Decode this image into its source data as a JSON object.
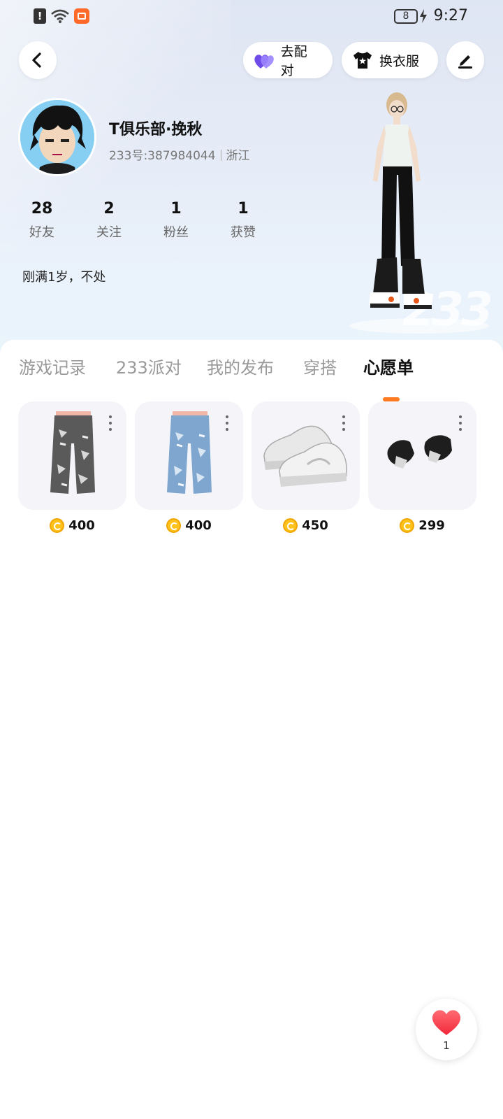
{
  "status_bar": {
    "time": "9:27",
    "battery": "8"
  },
  "header": {
    "pair_button": "去配对",
    "dress_button": "换衣服"
  },
  "profile": {
    "username": "T俱乐部·挽秋",
    "user_id": "233号:387984044",
    "region": "浙江",
    "bio": "刚满1岁，不处",
    "stats": [
      {
        "value": "28",
        "label": "好友"
      },
      {
        "value": "2",
        "label": "关注"
      },
      {
        "value": "1",
        "label": "粉丝"
      },
      {
        "value": "1",
        "label": "获赞"
      }
    ]
  },
  "tabs": [
    {
      "label": "游戏记录"
    },
    {
      "label": "233派对"
    },
    {
      "label": "我的发布"
    },
    {
      "label": "穿搭"
    },
    {
      "label": "心愿单"
    }
  ],
  "active_tab": "心愿单",
  "wishlist": [
    {
      "icon": "ripped-black-jeans",
      "price": "400"
    },
    {
      "icon": "ripped-blue-jeans",
      "price": "400"
    },
    {
      "icon": "white-sneakers",
      "price": "450"
    },
    {
      "icon": "black-gloves",
      "price": "299"
    }
  ],
  "like_count": "1",
  "colors": {
    "accent": "#ff7b22",
    "coin": "#ffc21a",
    "heart": "#ff4d5a",
    "pair_icon": "#7b5cf0"
  }
}
